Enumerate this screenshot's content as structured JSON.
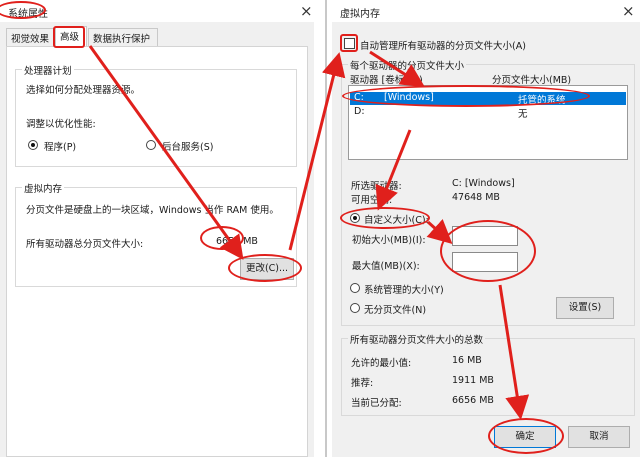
{
  "left_window": {
    "title": "系统属性",
    "tabs": [
      "视觉效果",
      "高级",
      "数据执行保护"
    ],
    "processor": {
      "title": "处理器计划",
      "desc": "选择如何分配处理器资源。",
      "adjust_label": "调整以优化性能:",
      "option_programs": "程序(P)",
      "option_services": "后台服务(S)"
    },
    "vm": {
      "title": "虚拟内存",
      "desc": "分页文件是硬盘上的一块区域，Windows 当作 RAM 使用。",
      "total_label": "所有驱动器总分页文件大小:",
      "total_value": "6656 MB",
      "change_button": "更改(C)..."
    }
  },
  "right_window": {
    "title": "虚拟内存",
    "auto_manage": "自动管理所有驱动器的分页文件大小(A)",
    "per_drive_title": "每个驱动器的分页文件大小",
    "columns": [
      "驱动器 [卷标](D)",
      "分页文件大小(MB)"
    ],
    "drives": [
      {
        "drive": "C:",
        "label": "[Windows]",
        "size": "托管的系统",
        "selected": true
      },
      {
        "drive": "D:",
        "label": "",
        "size": "无",
        "selected": false
      }
    ],
    "selected_drive_label": "所选驱动器:",
    "selected_drive_value": "C:  [Windows]",
    "free_space_label": "可用空间:",
    "free_space_value": "47648 MB",
    "custom_size": "自定义大小(C):",
    "initial_size_label": "初始大小(MB)(I):",
    "max_size_label": "最大值(MB)(X):",
    "initial_size_value": "",
    "max_size_value": "",
    "system_managed": "系统管理的大小(Y)",
    "no_paging": "无分页文件(N)",
    "set_button": "设置(S)",
    "totals_title": "所有驱动器分页文件大小的总数",
    "min_allowed_label": "允许的最小值:",
    "min_allowed_value": "16 MB",
    "recommended_label": "推荐:",
    "recommended_value": "1911 MB",
    "current_label": "当前已分配:",
    "current_value": "6656 MB",
    "ok_button": "确定",
    "cancel_button": "取消"
  },
  "accent_colors": {
    "annotation": "#e0201c",
    "selection": "#0078d7"
  }
}
